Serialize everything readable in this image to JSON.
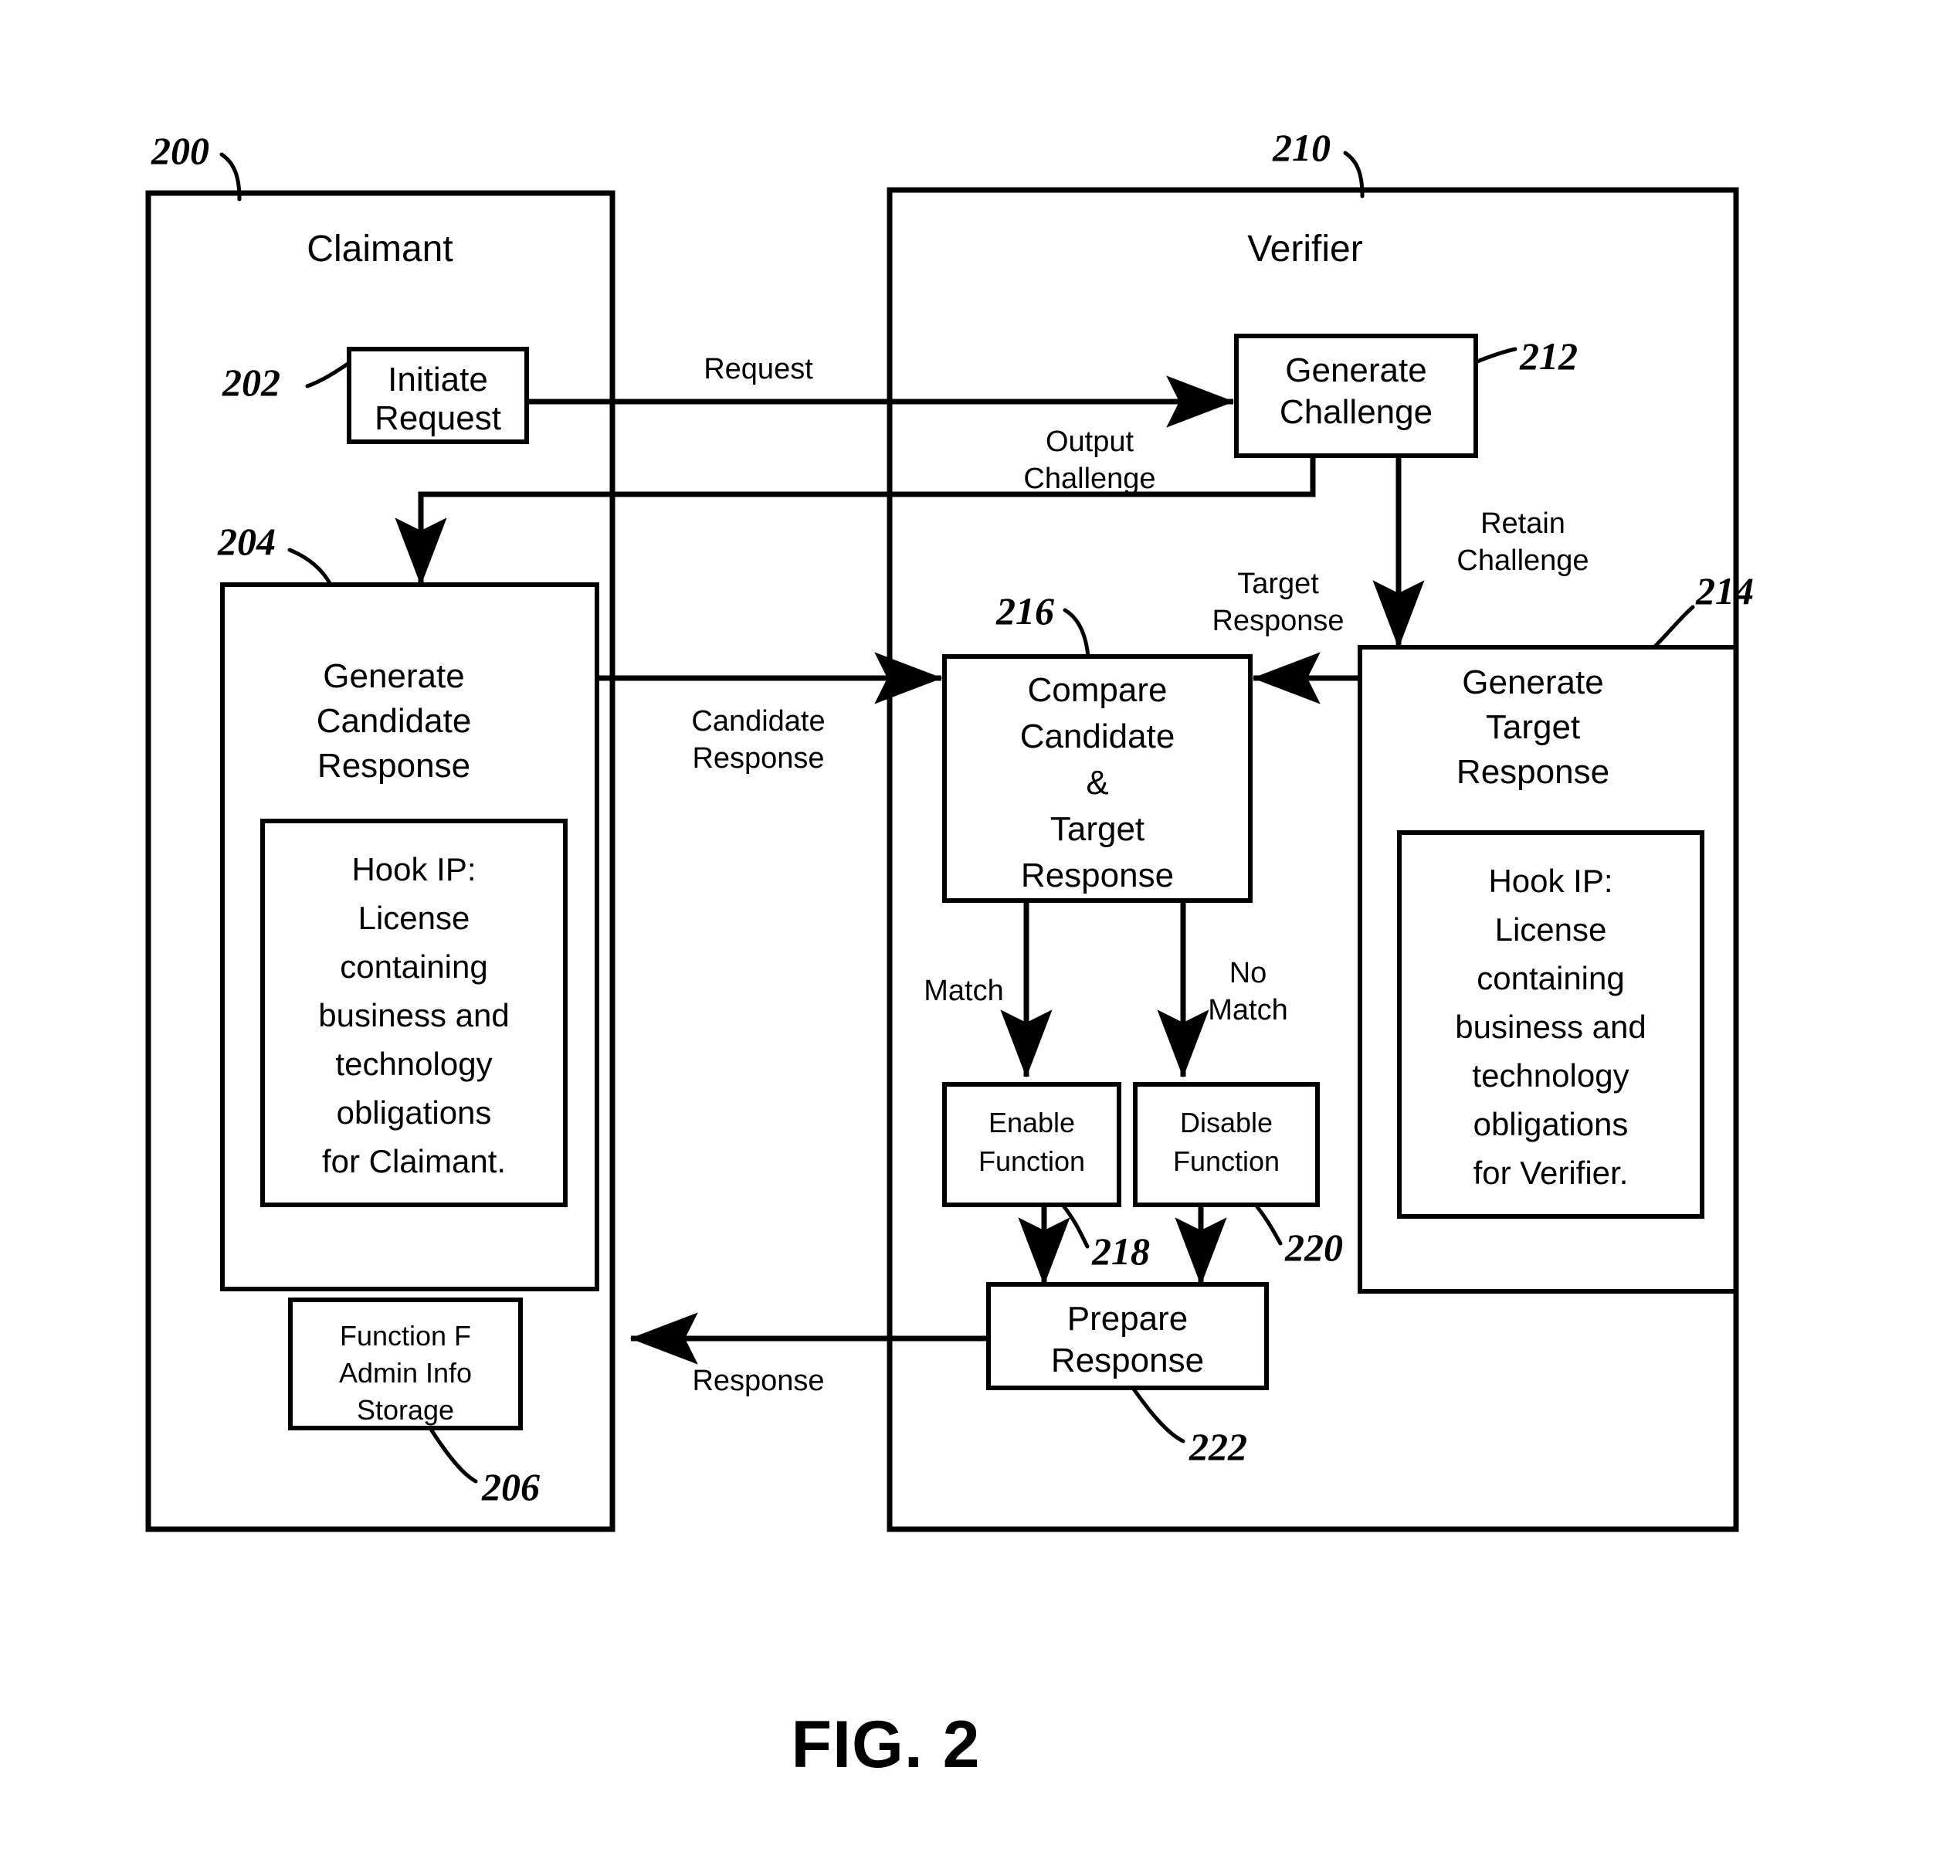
{
  "figure": {
    "caption": "FIG. 2"
  },
  "containers": [
    {
      "id": "claimant",
      "label": "Claimant",
      "ref": "200"
    },
    {
      "id": "verifier",
      "label": "Verifier",
      "ref": "210"
    }
  ],
  "claimant": {
    "title": "Claimant",
    "ref": "200",
    "initiate_request": {
      "ref": "202",
      "lines": [
        "Initiate",
        "Request"
      ]
    },
    "generate_candidate_response": {
      "ref": "204",
      "lines": [
        "Generate",
        "Candidate",
        "Response"
      ],
      "hook_ip": {
        "lines": [
          "Hook  IP:",
          "License",
          "containing",
          "business and",
          "technology",
          "obligations",
          "for Claimant."
        ]
      }
    },
    "function_storage": {
      "ref": "206",
      "lines": [
        "Function F",
        "Admin Info",
        "Storage"
      ]
    }
  },
  "verifier": {
    "title": "Verifier",
    "ref": "210",
    "generate_challenge": {
      "ref": "212",
      "lines": [
        "Generate",
        "Challenge"
      ]
    },
    "generate_target_response": {
      "ref": "214",
      "lines": [
        "Generate",
        "Target",
        "Response"
      ],
      "hook_ip": {
        "lines": [
          "Hook  IP:",
          "License",
          "containing",
          "business and",
          "technology",
          "obligations",
          "for Verifier."
        ]
      }
    },
    "compare": {
      "ref": "216",
      "lines": [
        "Compare",
        "Candidate",
        "&",
        "Target",
        "Response"
      ]
    },
    "enable_function": {
      "ref": "218",
      "lines": [
        "Enable",
        "Function"
      ]
    },
    "disable_function": {
      "ref": "220",
      "lines": [
        "Disable",
        "Function"
      ]
    },
    "prepare_response": {
      "ref": "222",
      "lines": [
        "Prepare",
        "Response"
      ]
    }
  },
  "edge_labels": {
    "request": "Request",
    "output_challenge": [
      "Output",
      "Challenge"
    ],
    "retain_challenge": [
      "Retain",
      "Challenge"
    ],
    "candidate_response": [
      "Candidate",
      "Response"
    ],
    "target_response": [
      "Target",
      "Response"
    ],
    "match": "Match",
    "no_match": [
      "No",
      "Match"
    ],
    "response": "Response"
  },
  "colors": {
    "stroke": "#000000",
    "background": "#ffffff"
  }
}
